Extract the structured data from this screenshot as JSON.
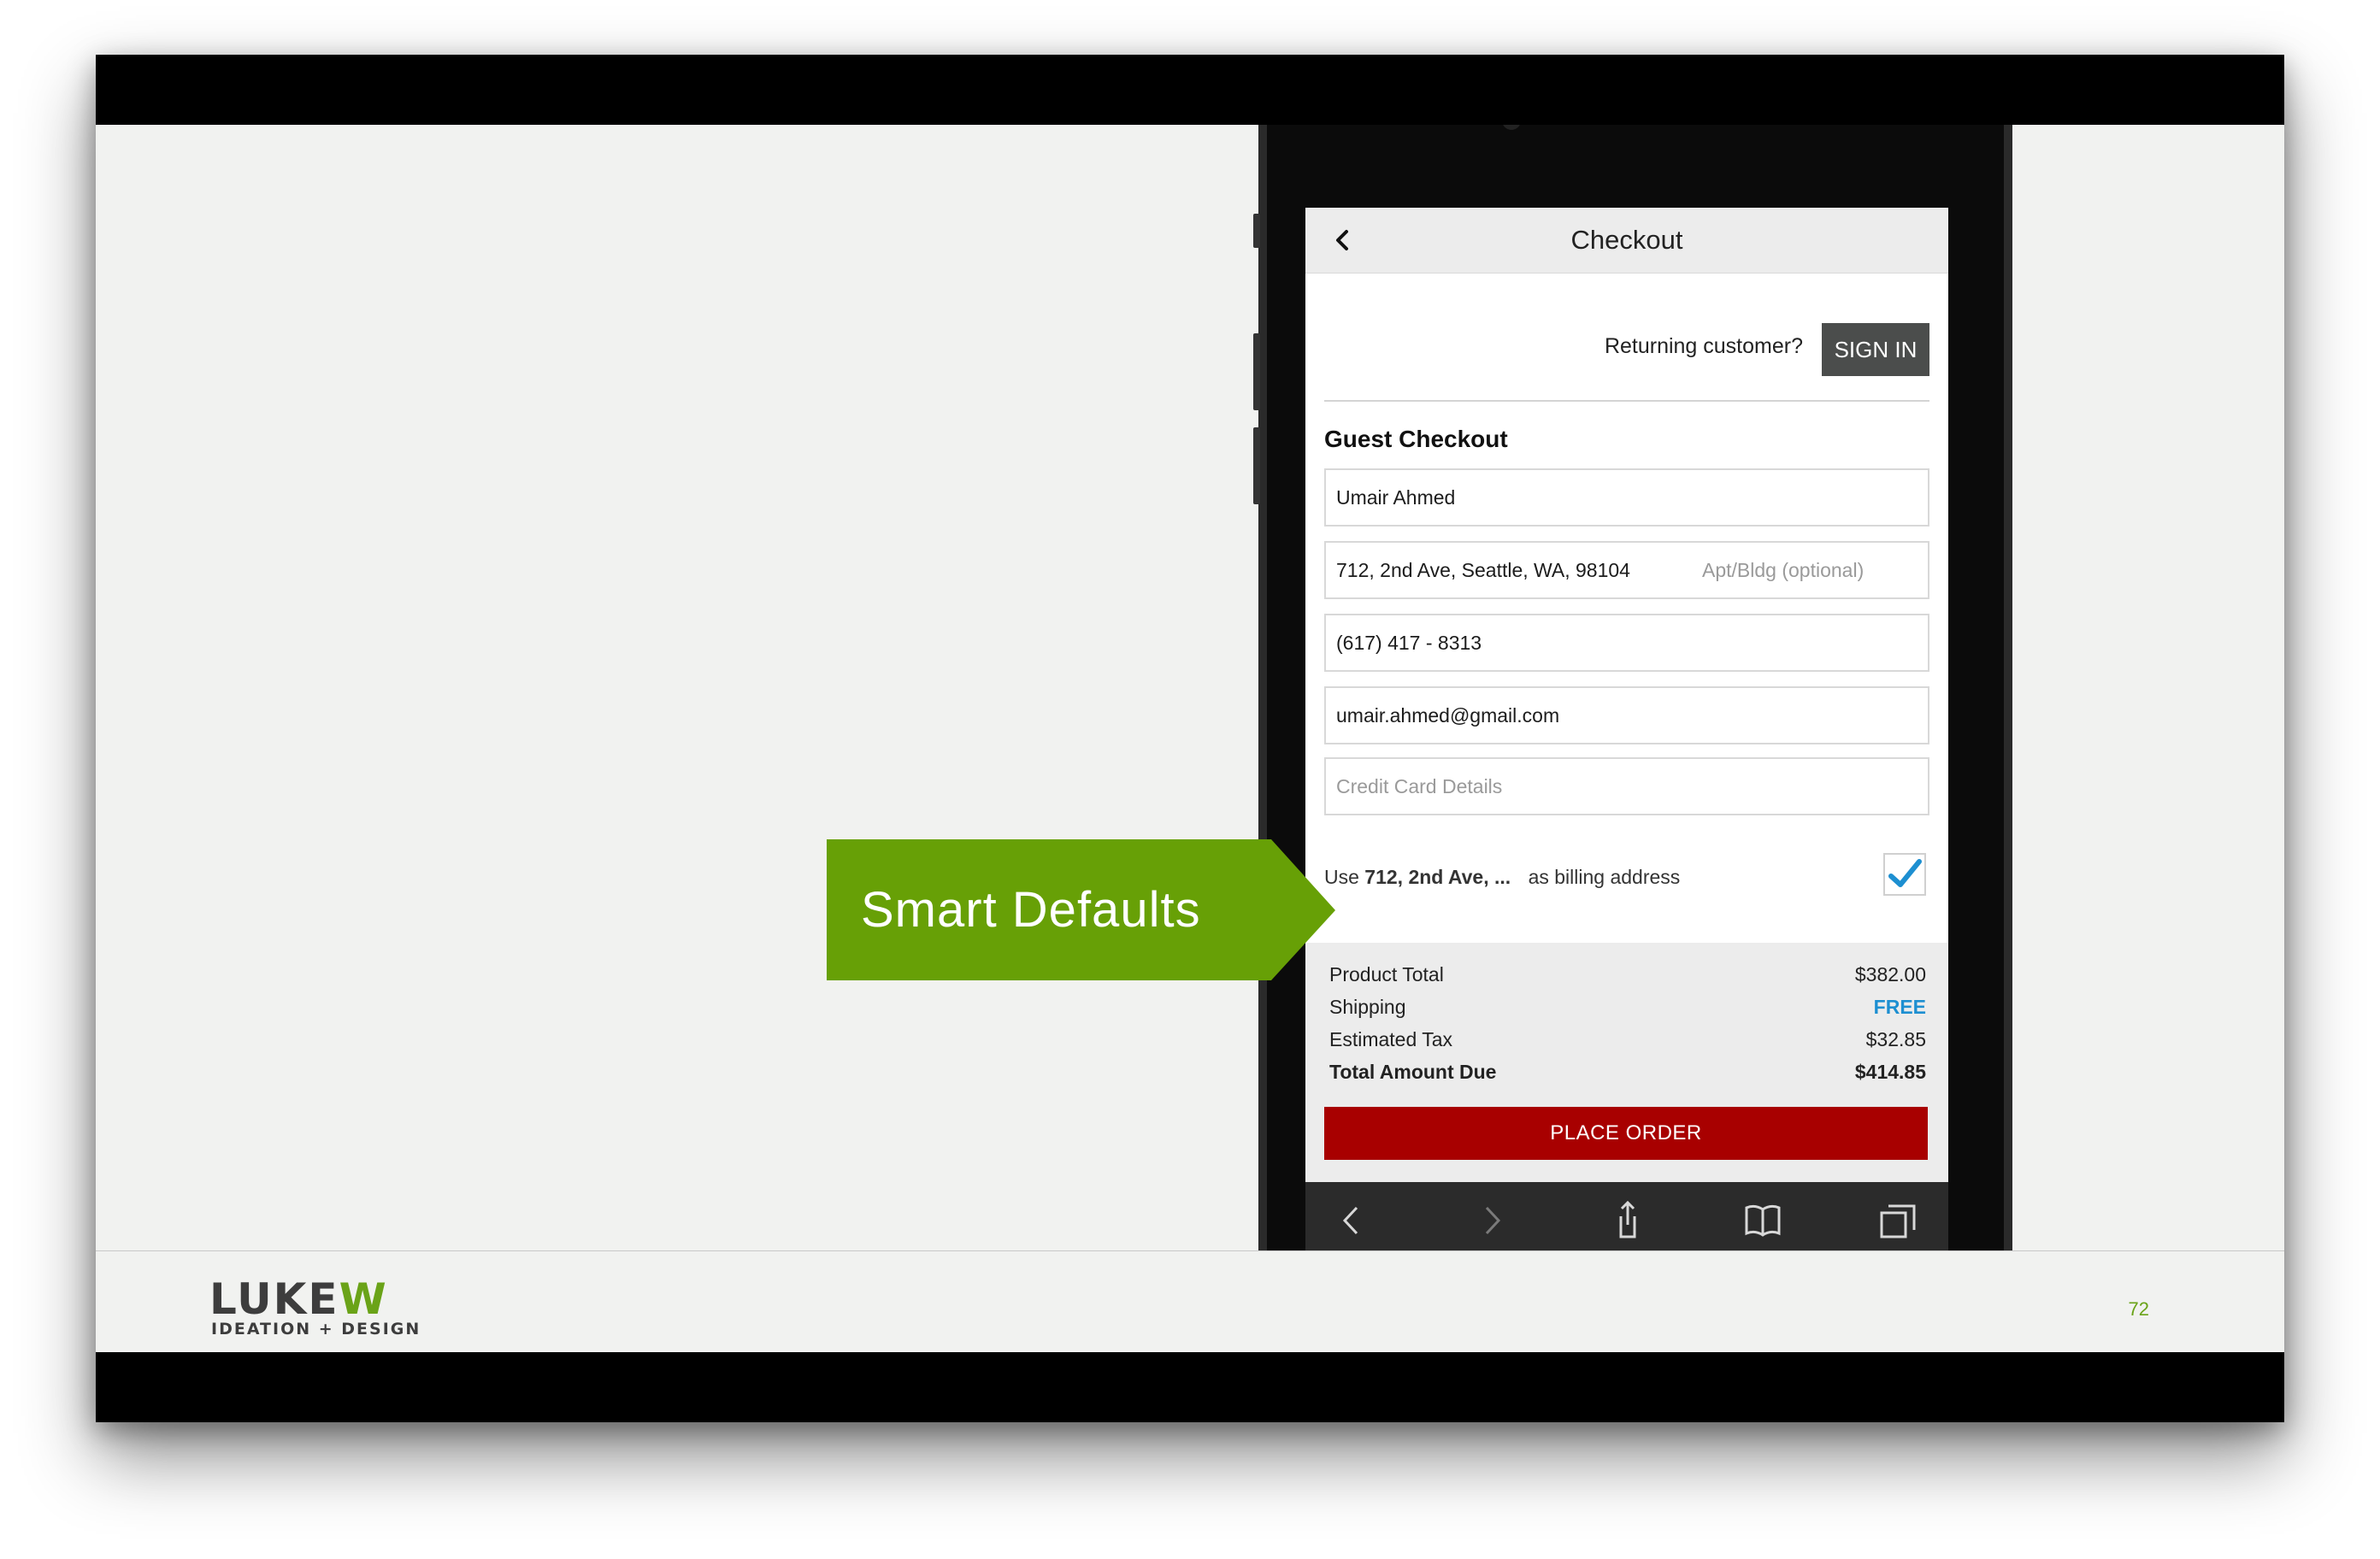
{
  "slide": {
    "logo_main_a": "LUKE",
    "logo_main_b": "W",
    "logo_sub": "IDEATION + DESIGN",
    "page_number": "72",
    "callout_text": "Smart Defaults"
  },
  "checkout": {
    "title": "Checkout",
    "back_icon": "chevron-left-icon",
    "returning_label": "Returning customer?",
    "signin_label": "SIGN IN",
    "section_title": "Guest Checkout",
    "name_value": "Umair Ahmed",
    "address_value": "712, 2nd Ave, Seattle, WA, 98104",
    "apt_placeholder": "Apt/Bldg (optional)",
    "phone_value": "(617) 417 - 8313",
    "email_value": "umair.ahmed@gmail.com",
    "card_placeholder": "Credit Card Details",
    "billing_prefix": "Use",
    "billing_address": "712, 2nd Ave, ...",
    "billing_suffix": "as billing address",
    "billing_checked": true,
    "summary": {
      "product_total_label": "Product Total",
      "product_total_value": "$382.00",
      "shipping_label": "Shipping",
      "shipping_value": "FREE",
      "tax_label": "Estimated Tax",
      "tax_value": "$32.85",
      "total_label": "Total Amount Due",
      "total_value": "$414.85"
    },
    "place_order_label": "PLACE ORDER",
    "accent_green": "#67a006",
    "place_order_color": "#a80000",
    "free_color": "#1d8fd1"
  },
  "browser_toolbar": [
    "back-arrow-icon",
    "forward-arrow-icon",
    "share-icon",
    "bookmarks-icon",
    "tabs-icon"
  ]
}
